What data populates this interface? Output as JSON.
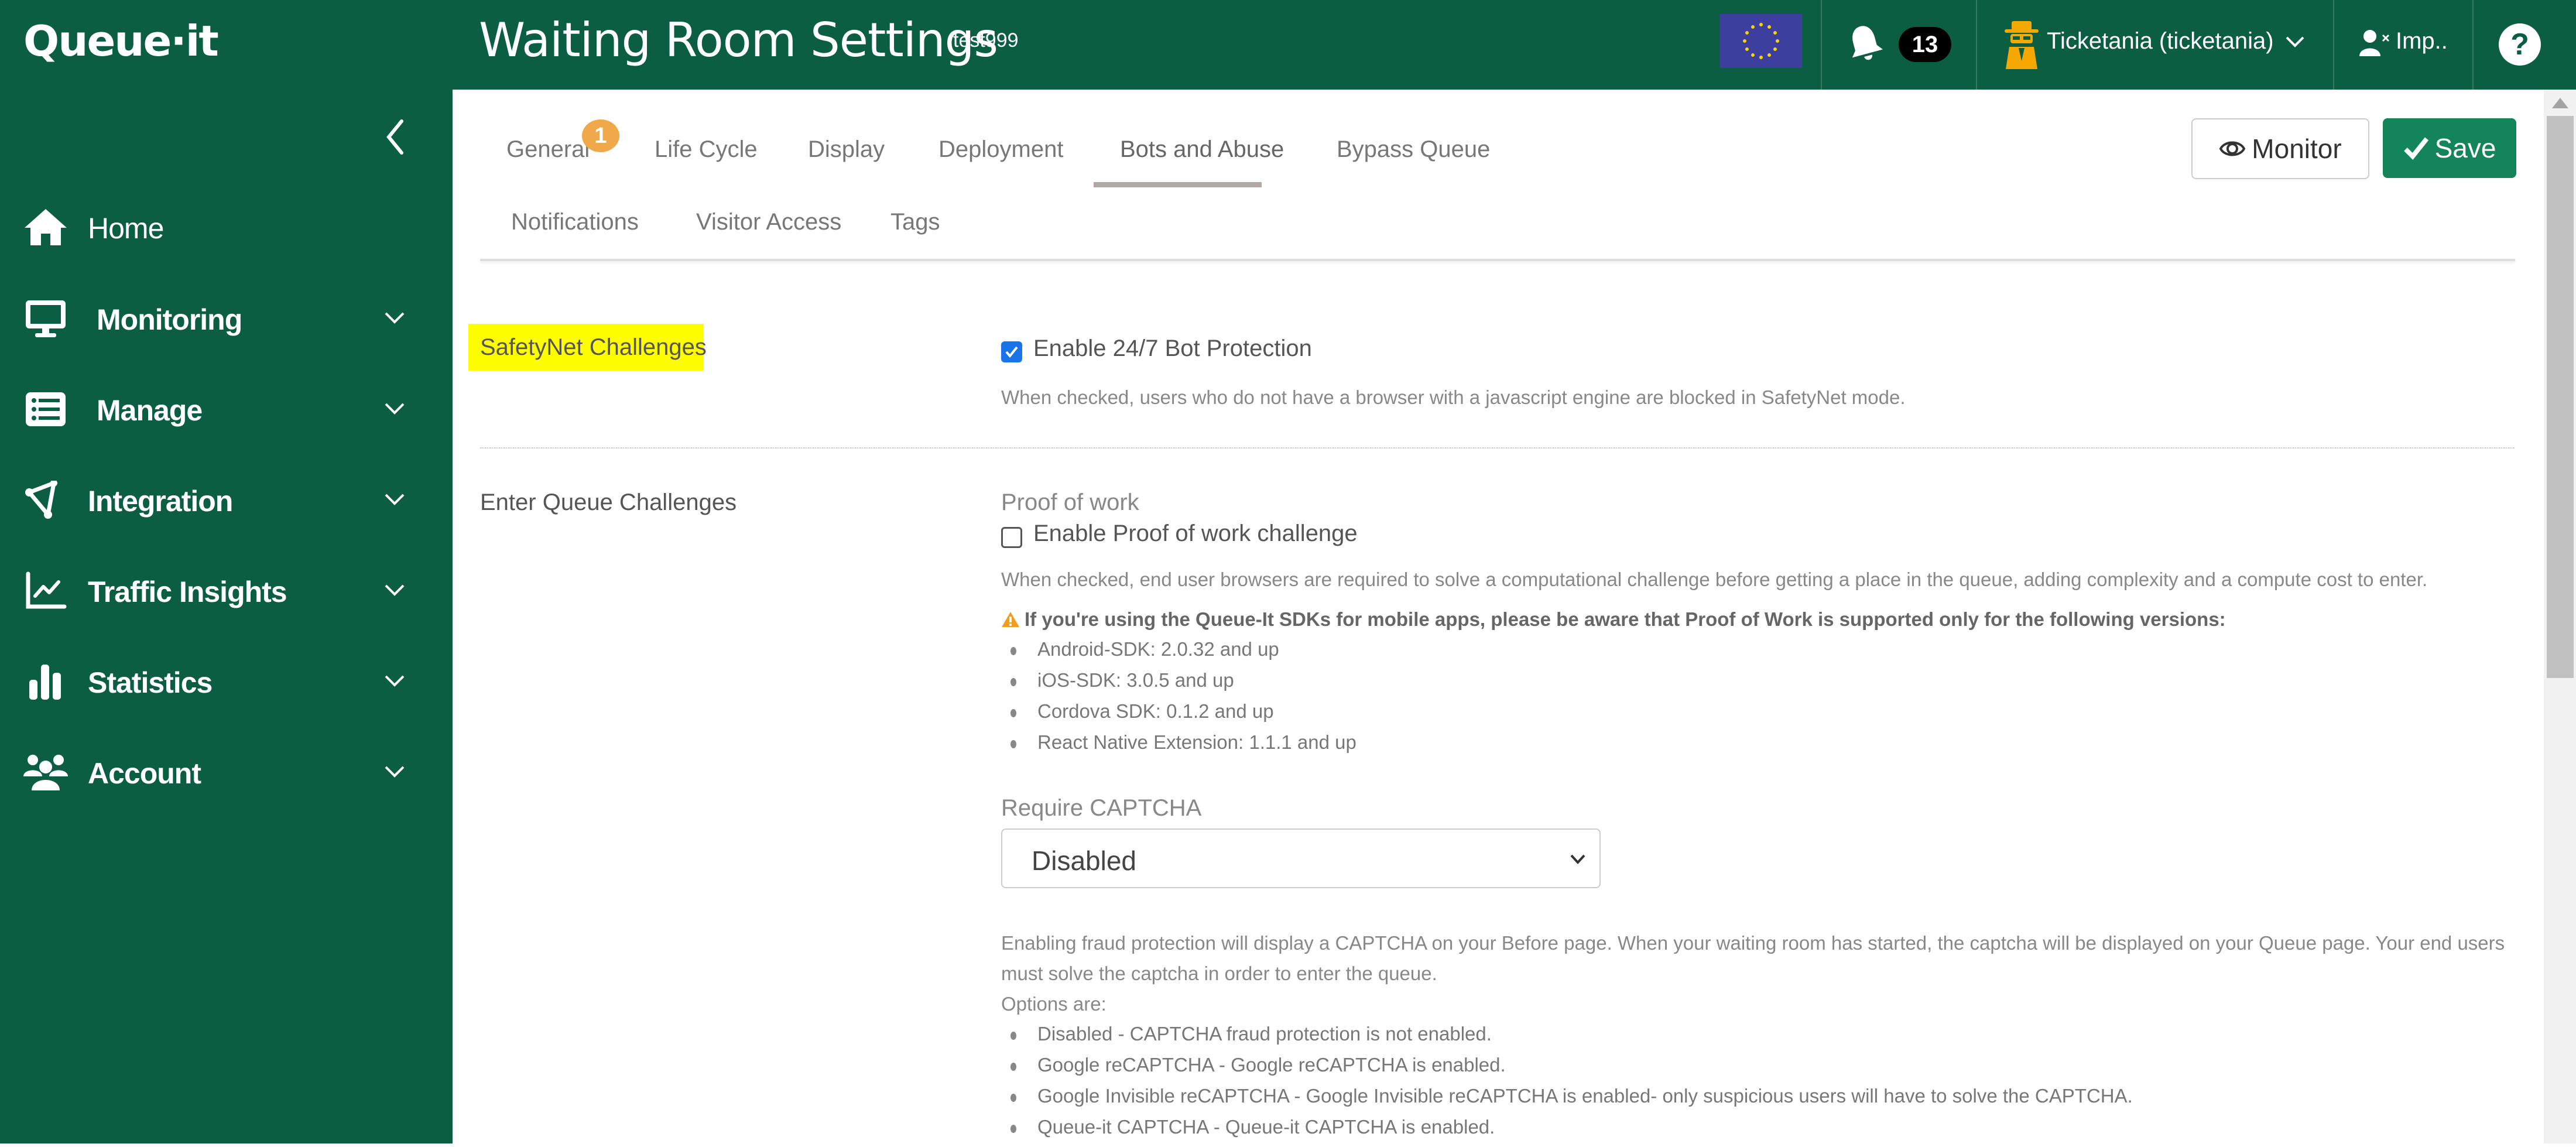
{
  "header": {
    "logo": "Queue·it",
    "title": "Waiting Room Settings",
    "subtitle": "test999",
    "region_flag": "eu-flag-icon",
    "notifications_count": "13",
    "user_name": "Ticketania (ticketania)",
    "impersonate_label": "Imp..",
    "help_label": "?"
  },
  "sidebar": {
    "items": [
      {
        "label": "Home",
        "icon": "home-icon",
        "expandable": false
      },
      {
        "label": "Monitoring",
        "icon": "monitor-icon",
        "expandable": true
      },
      {
        "label": "Manage",
        "icon": "list-icon",
        "expandable": true
      },
      {
        "label": "Integration",
        "icon": "integration-icon",
        "expandable": true
      },
      {
        "label": "Traffic Insights",
        "icon": "line-chart-icon",
        "expandable": true
      },
      {
        "label": "Statistics",
        "icon": "bar-chart-icon",
        "expandable": true
      },
      {
        "label": "Account",
        "icon": "users-icon",
        "expandable": true
      }
    ]
  },
  "tabs": {
    "row1": [
      {
        "label": "General",
        "badge": "1"
      },
      {
        "label": "Life Cycle"
      },
      {
        "label": "Display"
      },
      {
        "label": "Deployment"
      },
      {
        "label": "Bots and Abuse",
        "active": true
      },
      {
        "label": "Bypass Queue"
      }
    ],
    "row2": [
      {
        "label": "Notifications"
      },
      {
        "label": "Visitor Access"
      },
      {
        "label": "Tags"
      }
    ]
  },
  "actions": {
    "monitor_label": "Monitor",
    "save_label": "Save"
  },
  "colors": {
    "brand_green": "#0c5e42",
    "save_green": "#138559",
    "badge_orange": "#efa94a",
    "highlight_yellow": "#fffe00",
    "checkbox_blue": "#1a73e8"
  },
  "safetynet": {
    "section_label": "SafetyNet Challenges",
    "checkbox_label": "Enable 24/7 Bot Protection",
    "checked": true,
    "help": "When checked, users who do not have a browser with a javascript engine are blocked in SafetyNet mode."
  },
  "enter_queue": {
    "section_label": "Enter Queue Challenges",
    "pow_label": "Proof of work",
    "pow_checkbox_label": "Enable Proof of work challenge",
    "pow_checked": false,
    "pow_help": "When checked, end user browsers are required to solve a computational challenge before getting a place in the queue, adding complexity and a compute cost to enter.",
    "warning": "If you're using the Queue-It SDKs for mobile apps, please be aware that Proof of Work is supported only for the following versions:",
    "sdk_versions": [
      "Android-SDK: 2.0.32 and up",
      "iOS-SDK: 3.0.5 and up",
      "Cordova SDK: 0.1.2 and up",
      "React Native Extension: 1.1.1 and up"
    ],
    "captcha_label": "Require CAPTCHA",
    "captcha_value": "Disabled",
    "captcha_help_line1": "Enabling fraud protection will display a CAPTCHA on your Before page. When your waiting room has started, the captcha will be displayed on your Queue page. Your end users",
    "captcha_help_line2": "must solve the captcha in order to enter the queue.",
    "options_intro": "Options are:",
    "captcha_options": [
      "Disabled - CAPTCHA fraud protection is not enabled.",
      "Google reCAPTCHA - Google reCAPTCHA is enabled.",
      "Google Invisible reCAPTCHA - Google Invisible reCAPTCHA is enabled- only suspicious users will have to solve the CAPTCHA.",
      "Queue-it CAPTCHA - Queue-it CAPTCHA is enabled."
    ]
  }
}
